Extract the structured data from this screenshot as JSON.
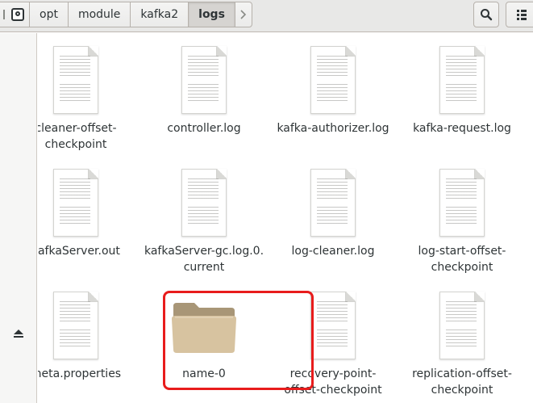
{
  "pathbar": {
    "crumbs": [
      "opt",
      "module",
      "kafka2",
      "logs"
    ],
    "active_index": 3
  },
  "header": {
    "search_icon": "search-icon",
    "view_icon": "list-view-icon"
  },
  "sidebar": {
    "eject_icon": "eject-icon"
  },
  "files": [
    {
      "label": "cleaner-offset-\ncheckpoint",
      "type": "document"
    },
    {
      "label": "controller.log",
      "type": "document"
    },
    {
      "label": "kafka-authorizer.log",
      "type": "document"
    },
    {
      "label": "kafka-request.log",
      "type": "document"
    },
    {
      "label": "kafkaServer.out",
      "type": "document"
    },
    {
      "label": "kafkaServer-gc.log.0.\ncurrent",
      "type": "document"
    },
    {
      "label": "log-cleaner.log",
      "type": "document"
    },
    {
      "label": "log-start-offset-\ncheckpoint",
      "type": "document"
    },
    {
      "label": "meta.properties",
      "type": "document"
    },
    {
      "label": "name-0",
      "type": "folder"
    },
    {
      "label": "recovery-point-\noffset-checkpoint",
      "type": "document"
    },
    {
      "label": "replication-offset-\ncheckpoint",
      "type": "document"
    }
  ],
  "colors": {
    "highlight": "#e81c1c",
    "folder": "#d7c3a0"
  }
}
